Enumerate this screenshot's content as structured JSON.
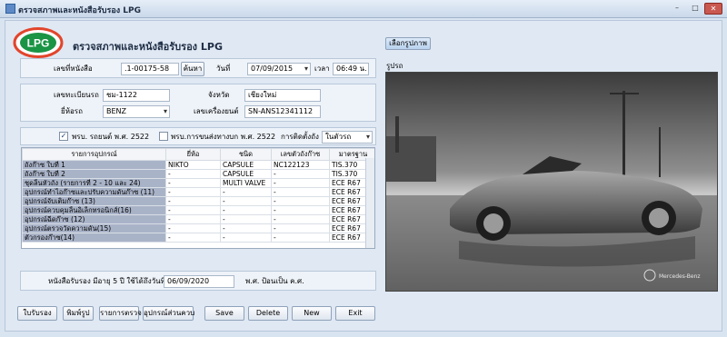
{
  "window": {
    "title": "ตรวจสภาพและหนังสือรับรอง LPG",
    "min": "–",
    "max": "□",
    "close": "✕"
  },
  "header": {
    "logo_text": "LPG",
    "title": "ตรวจสภาพและหนังสือรับรอง LPG"
  },
  "cert": {
    "no_label": "เลขที่หนังสือ",
    "no_value": ".1-00175-58",
    "search_label": "ค้นหา",
    "date_label": "วันที่",
    "date_value": "07/09/2015",
    "time_label": "เวลา",
    "time_value": "06:49 น."
  },
  "vehicle": {
    "plate_label": "เลขทะเบียนรถ",
    "plate_value": "ชม-1122",
    "province_label": "จังหวัด",
    "province_value": "เชียงใหม่",
    "brand_label": "ยี่ห้อรถ",
    "brand_value": "BENZ",
    "engine_label": "เลขเครื่องยนต์",
    "engine_value": "SN-ANS12341112"
  },
  "options": {
    "car_act_label": "พรบ. รถยนต์  พ.ศ. 2522",
    "car_act_checked": true,
    "transport_act_label": "พรบ.การขนส่งทางบก  พ.ศ. 2522",
    "transport_act_checked": false,
    "install_label": "การติดตั้งถัง",
    "install_value": "ในตัวรถ"
  },
  "table": {
    "headers": [
      "รายการอุปกรณ์",
      "ยี่ห้อ",
      "ชนิด",
      "เลขตัวถังก๊าซ",
      "มาตรฐาน"
    ],
    "rows": [
      [
        "ถังก๊าซ ใบที่ 1",
        "NIKTO",
        "CAPSULE",
        "NC122123",
        "TIS.370"
      ],
      [
        "ถังก๊าซ ใบที่ 2",
        "-",
        "CAPSULE",
        "-",
        "TIS.370"
      ],
      [
        "ชุดลิ้นหัวถัง (รายการที่ 2 - 10 และ 24)",
        "-",
        "MULTI VALVE",
        "-",
        "ECE R67"
      ],
      [
        "อุปกรณ์ทำไอก๊าซและปรับความดันก๊าซ (11)",
        "-",
        "-",
        "-",
        "ECE R67"
      ],
      [
        "อุปกรณ์จับเติมก๊าซ (13)",
        "-",
        "-",
        "-",
        "ECE R67"
      ],
      [
        "อุปกรณ์ควบคุมลิ้นอิเล็กทรอนิกส์(16)",
        "-",
        "-",
        "-",
        "ECE R67"
      ],
      [
        "อุปกรณ์ฉีดก๊าซ (12)",
        "-",
        "-",
        "-",
        "ECE R67"
      ],
      [
        "อุปกรณ์ตรวจวัดความดัน(15)",
        "-",
        "-",
        "-",
        "ECE R67"
      ],
      [
        "ตัวกรองก๊าซ(14)",
        "-",
        "-",
        "-",
        "ECE R67"
      ]
    ]
  },
  "expiry": {
    "label": "หนังสือรับรอง มีอายุ 5 ปี ใช้ได้ถึงวันที่",
    "value": "06/09/2020",
    "suffix": "พ.ศ. ป้อนเป็น ค.ศ."
  },
  "photo": {
    "select_label": "เลือกรูปภาพ",
    "caption": "รูปรถ",
    "watermark": "Mercedes-Benz"
  },
  "buttons": {
    "receipt": "ใบรับรอง",
    "print_photo": "พิมพ์รูป",
    "inspect_list": "รายการตรวจ",
    "parts": "อุปกรณ์ส่วนควบ",
    "save": "Save",
    "delete": "Delete",
    "new": "New",
    "exit": "Exit"
  },
  "colors": {
    "accent": "#2f6fc0",
    "logo_ring": "#e2452c",
    "logo_fill": "#1a9445"
  }
}
